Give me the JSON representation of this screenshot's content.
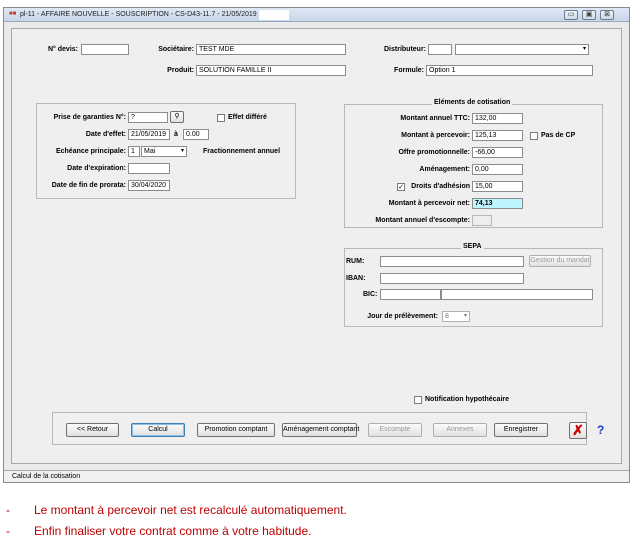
{
  "window": {
    "title": "pl-11 - AFFAIRE NOUVELLE - SOUSCRIPTION - CS-D43-11.7 - 21/05/2019 -",
    "app_icon": "app-logo-icon",
    "controls": {
      "minimize": "▭",
      "restore": "▣",
      "close": "⊠"
    }
  },
  "header": {
    "num_devis_label": "N° devis:",
    "num_devis_value": "",
    "societaire_label": "Sociétaire:",
    "societaire_value": "TEST MDE",
    "distributeur_label": "Distributeur:",
    "distributeur_code": "",
    "distributeur_name": "",
    "produit_label": "Produit:",
    "produit_value": "SOLUTION FAMILLE II",
    "formule_label": "Formule:",
    "formule_value": "Option 1"
  },
  "garanties": {
    "prise_label": "Prise de garanties N°:",
    "prise_value": "?",
    "effet_differe_label": "Effet différé",
    "effet_differe_checked": false,
    "date_effet_label": "Date d'effet:",
    "date_effet_value": "21/05/2019",
    "a_label": "à",
    "heure_value": "0.00",
    "echeance_label": "Echéance principale:",
    "echeance_jour": "1",
    "echeance_mois": "Mai",
    "fractionnement_label": "Fractionnement annuel",
    "date_expiration_label": "Date d'expiration:",
    "date_expiration_value": "",
    "date_fin_prorata_label": "Date de fin de prorata:",
    "date_fin_prorata_value": "30/04/2020"
  },
  "cotisation": {
    "group_title": "Eléments de cotisation",
    "montant_annuel_ttc_label": "Montant annuel TTC:",
    "montant_annuel_ttc_value": "132,00",
    "montant_percevoir_label": "Montant à percevoir:",
    "montant_percevoir_value": "125,13",
    "pas_de_cp_label": "Pas de CP",
    "pas_de_cp_checked": false,
    "offre_promo_label": "Offre promotionnelle:",
    "offre_promo_value": "-66,00",
    "amenagement_label": "Aménagement:",
    "amenagement_value": "0,00",
    "droits_adhesion_label": "Droits d'adhésion",
    "droits_adhesion_checked": true,
    "droits_adhesion_value": "15,00",
    "montant_net_label": "Montant à percevoir net:",
    "montant_net_value": "74,13",
    "montant_escompte_label": "Montant annuel d'escompte:",
    "montant_escompte_value": ""
  },
  "sepa": {
    "group_title": "SEPA",
    "rum_label": "RUM:",
    "rum_value": "",
    "gestion_mandat_label": "Gestion du mandat",
    "iban_label": "IBAN:",
    "iban_value": "",
    "bic_label": "BIC:",
    "bic_value": "",
    "bic_bank": "",
    "jour_prelevement_label": "Jour de prélèvement:",
    "jour_prelevement_value": "8"
  },
  "notification_label": "Notification hypothécaire",
  "notification_checked": false,
  "buttons": {
    "retour": "<< Retour",
    "calcul": "Calcul",
    "promotion": "Promotion comptant",
    "amenagement": "Aménagement comptant",
    "escompte": "Escompte",
    "annexes": "Annexes",
    "enregistrer": "Enregistrer",
    "cancel_icon": "✗",
    "help": "?"
  },
  "status_text": "Calcul de la cotisation",
  "notes": [
    "Le montant à percevoir net est recalculé automatiquement.",
    "Enfin finaliser votre contrat comme à votre habitude."
  ],
  "colors": {
    "highlight_field": "#bff5ff",
    "note_text": "#c00000",
    "cancel_red": "#cc0000",
    "help_blue": "#1a3ccc"
  }
}
